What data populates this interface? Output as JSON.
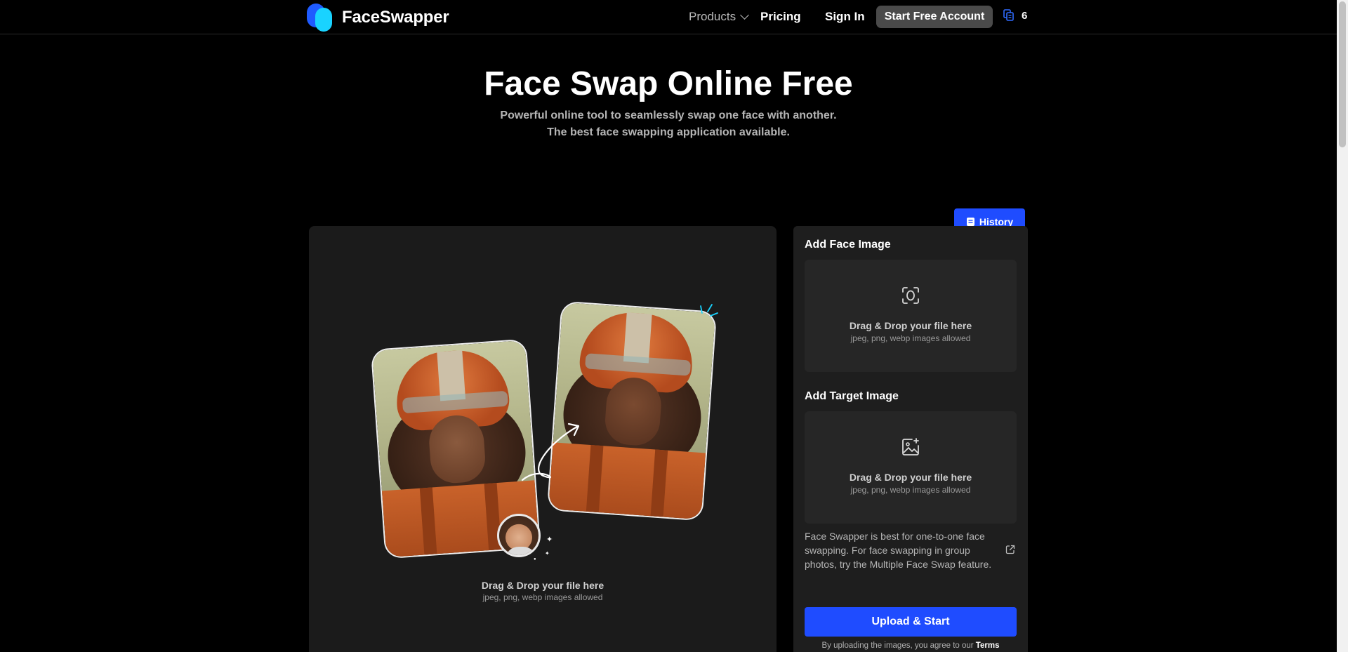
{
  "header": {
    "logo_text": "FaceSwapper",
    "nav_products": "Products",
    "nav_pricing": "Pricing",
    "nav_signin": "Sign In",
    "start_button": "Start Free Account",
    "credits_count": "6"
  },
  "hero": {
    "title": "Face Swap Online Free",
    "subtitle": "Powerful online tool to seamlessly swap one face with another. The best face swapping application available."
  },
  "main_upload": {
    "drop_title": "Drag & Drop your file here",
    "drop_hint": "jpeg, png, webp images allowed"
  },
  "sidebar": {
    "history_label": "History",
    "face_section_title": "Add Face Image",
    "target_section_title": "Add Target Image",
    "drop_title": "Drag & Drop your file here",
    "drop_hint": "jpeg, png, webp images allowed",
    "note": "Face Swapper is best for one-to-one face swapping. For face swapping in group photos, try the Multiple Face Swap feature.",
    "upload_button": "Upload & Start",
    "terms_prefix": "By uploading the images, you agree to our ",
    "terms_link": "Terms"
  },
  "colors": {
    "accent": "#1f4cff",
    "logo_blue": "#1f5bff",
    "logo_cyan": "#19d3ff",
    "panel_bg": "#1b1b1b"
  }
}
